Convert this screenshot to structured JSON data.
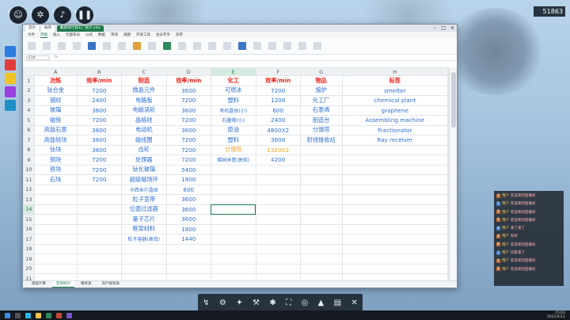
{
  "game": {
    "top_buttons": [
      {
        "icon": "user-icon",
        "glyph": "☺",
        "badge": "1"
      },
      {
        "icon": "gear-icon",
        "glyph": "✲",
        "badge": "2"
      },
      {
        "icon": "music-icon",
        "glyph": "♪",
        "badge": "3"
      },
      {
        "icon": "pause-icon",
        "glyph": "❚❚",
        "badge": "4"
      }
    ],
    "resource_count": "51863",
    "hotbar": [
      "↯",
      "⚙",
      "✦",
      "⚒",
      "✱",
      "⛶",
      "◎",
      "▲",
      "▤",
      "✕"
    ]
  },
  "spreadsheet": {
    "doc_tabs": [
      "首页",
      "稻壳",
      "戴森球计划工厂统计.xlsx"
    ],
    "menus": [
      "文件",
      "开始",
      "插入",
      "页面布局",
      "公式",
      "数据",
      "审阅",
      "视图",
      "开发工具",
      "会员专享",
      "效率"
    ],
    "active_menu": "开始",
    "name_box": "E14",
    "fx": "fx",
    "columns": [
      "A",
      "B",
      "C",
      "D",
      "E",
      "F",
      "G",
      "H"
    ],
    "selected_column": "E",
    "selected_row": 14,
    "header": [
      "冶炼",
      "效率/min",
      "制造",
      "效率/min",
      "化工",
      "效率/min",
      "物品",
      "标签"
    ],
    "rows": [
      [
        "钛合金",
        "7200",
        "微晶元件",
        "3600",
        "可燃冰",
        "7200",
        "熔炉",
        "smelter"
      ],
      [
        "钢材",
        "2400",
        "电路板",
        "7200",
        "塑料",
        "1200",
        "化工厂",
        "chemical plant"
      ],
      [
        "玻璃",
        "3600",
        "电磁涡轮",
        "3600",
        "有机晶体(小)",
        "600",
        "石墨烯",
        "graphene"
      ],
      [
        "磁铁",
        "7200",
        "晶格硅",
        "7200",
        "石墨烯(小)",
        "2400",
        "制造台",
        "Assembling machine"
      ],
      [
        "高能石墨",
        "3600",
        "电动机",
        "3600",
        "原油",
        "4800X2",
        "分馏塔",
        "Fractionator"
      ],
      [
        "高能硅块",
        "3600",
        "磁线圈",
        "7200",
        "塑料",
        "3600",
        "射线接收站",
        "Ray receiver"
      ],
      [
        "钛块",
        "3600",
        "齿轮",
        "7200",
        "分馏塔",
        "1320X2",
        "",
        ""
      ],
      [
        "铜块",
        "7200",
        "处理器",
        "7200",
        "碳纳米管(高效)",
        "4200",
        "",
        ""
      ],
      [
        "铁块",
        "7200",
        "钛化玻璃",
        "5400",
        "",
        "",
        "",
        ""
      ],
      [
        "石块",
        "7200",
        "超级磁场环",
        "1800",
        "",
        "",
        "",
        ""
      ],
      [
        "",
        "",
        "卡西米尔晶体",
        "600",
        "",
        "",
        "",
        ""
      ],
      [
        "",
        "",
        "粒子宽带",
        "3600",
        "",
        "",
        "",
        ""
      ],
      [
        "",
        "",
        "位面过滤器",
        "3600",
        "",
        "",
        "",
        ""
      ],
      [
        "",
        "",
        "量子芯片",
        "3600",
        "",
        "",
        "",
        ""
      ],
      [
        "",
        "",
        "框架材料",
        "1800",
        "",
        "",
        "",
        ""
      ],
      [
        "",
        "",
        "粒子容器(高效)",
        "1440",
        "",
        "",
        "",
        ""
      ],
      [
        "",
        "",
        "",
        "",
        "",
        "",
        "",
        ""
      ],
      [
        "",
        "",
        "",
        "",
        "",
        "",
        "",
        ""
      ],
      [
        "",
        "",
        "",
        "",
        "",
        "",
        "",
        ""
      ],
      [
        "",
        "",
        "",
        "",
        "",
        "",
        "",
        ""
      ]
    ],
    "row_numbers": [
      "1",
      "2",
      "3",
      "4",
      "5",
      "6",
      "7",
      "8",
      "9",
      "10",
      "11",
      "12",
      "13",
      "14",
      "15",
      "16",
      "17",
      "18",
      "19",
      "20",
      "21"
    ],
    "sheet_tabs": [
      "基础计算",
      "宏观统计",
      "精炼表",
      "资产规划表"
    ],
    "active_sheet": "宏观统计"
  },
  "colors": {
    "header_red": "#e8231b",
    "value_blue": "#2f6fd0",
    "highlight_orange": "#f0a21c",
    "accent_green": "#1e7a4d"
  },
  "chat": {
    "lines": [
      {
        "tag": "3",
        "user": "用户",
        "msg": "欢迎来到直播间"
      },
      {
        "tag": "5",
        "user": "用户",
        "msg": "欢迎来到直播间"
      },
      {
        "tag": "2",
        "user": "用户",
        "msg": "欢迎来到直播间"
      },
      {
        "tag": "1",
        "user": "用户",
        "msg": "欢迎来到直播间"
      },
      {
        "tag": "4",
        "user": "用户",
        "msg": "来了来了"
      },
      {
        "tag": "2",
        "user": "用户",
        "msg": "你好"
      },
      {
        "tag": "6",
        "user": "用户",
        "msg": "欢迎来到直播间"
      },
      {
        "tag": "3",
        "user": "用户",
        "msg": "玩家来了"
      },
      {
        "tag": "1",
        "user": "用户",
        "msg": "欢迎来到直播间"
      },
      {
        "tag": "2",
        "user": "用户",
        "msg": "欢迎来到直播间"
      }
    ]
  },
  "taskbar": {
    "time": "15:03",
    "date": "2021/4/12"
  }
}
